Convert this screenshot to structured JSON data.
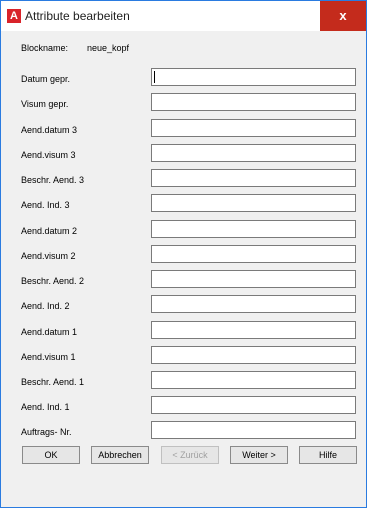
{
  "window": {
    "title": "Attribute bearbeiten",
    "app_icon_letter": "A",
    "close_glyph": "x"
  },
  "blockname": {
    "label": "Blockname:",
    "value": "neue_kopf"
  },
  "fields": [
    {
      "label": "Datum gepr.",
      "value": ""
    },
    {
      "label": "Visum gepr.",
      "value": ""
    },
    {
      "label": "Aend.datum 3",
      "value": ""
    },
    {
      "label": "Aend.visum 3",
      "value": ""
    },
    {
      "label": "Beschr. Aend. 3",
      "value": ""
    },
    {
      "label": "Aend. Ind. 3",
      "value": ""
    },
    {
      "label": "Aend.datum 2",
      "value": ""
    },
    {
      "label": "Aend.visum 2",
      "value": ""
    },
    {
      "label": "Beschr. Aend. 2",
      "value": ""
    },
    {
      "label": "Aend. Ind. 2",
      "value": ""
    },
    {
      "label": "Aend.datum 1",
      "value": ""
    },
    {
      "label": "Aend.visum 1",
      "value": ""
    },
    {
      "label": "Beschr. Aend. 1",
      "value": ""
    },
    {
      "label": "Aend. Ind. 1",
      "value": ""
    },
    {
      "label": "Auftrags- Nr.",
      "value": ""
    }
  ],
  "buttons": {
    "ok": "OK",
    "cancel": "Abbrechen",
    "back": "< Zurück",
    "next": "Weiter >",
    "help": "Hilfe"
  }
}
